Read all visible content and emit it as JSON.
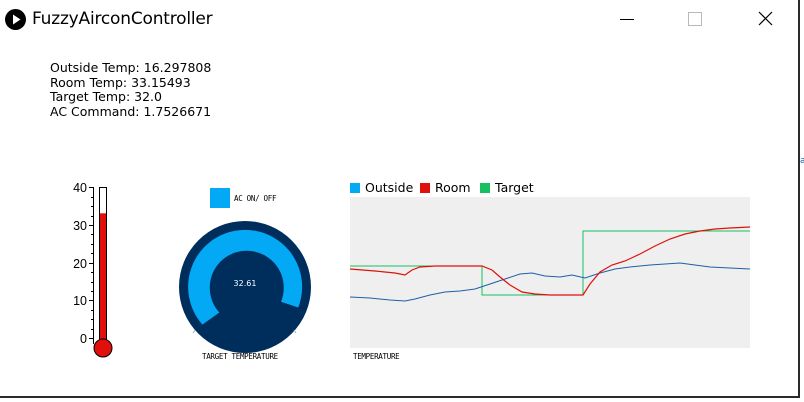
{
  "window": {
    "title": "FuzzyAirconController",
    "buttons": [
      "minimize",
      "maximize",
      "close"
    ]
  },
  "readouts": {
    "outside_temp": "Outside Temp: 16.297808",
    "room_temp": "Room Temp: 33.15493",
    "target_temp": "Target Temp: 32.0",
    "ac_command": "AC Command: 1.7526671"
  },
  "thermometer": {
    "ticks": [
      "40",
      "30",
      "20",
      "10",
      "0"
    ],
    "min": 0,
    "max": 40,
    "level": 33.15493,
    "color": "#e0100a"
  },
  "ac_toggle": {
    "label": "AC ON/ OFF",
    "state": "on",
    "color": "#03a9f4"
  },
  "knob": {
    "value_text": "32.61",
    "caption": "TARGET TEMPERATURE",
    "ring_color": "#002e5c",
    "arc_color": "#03a9f4"
  },
  "chart_data": {
    "type": "line",
    "xlabel": "TEMPERATURE",
    "legend_position": "top-left",
    "series": [
      {
        "name": "Outside",
        "color": "#03a9f4"
      },
      {
        "name": "Room",
        "color": "#e0100a"
      },
      {
        "name": "Target",
        "color": "#16c060"
      }
    ]
  }
}
